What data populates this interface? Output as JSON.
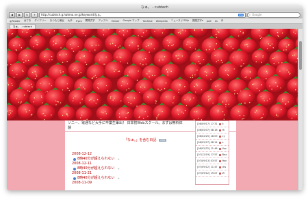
{
  "window": {
    "title": "なぁ。 - cubtech"
  },
  "toolbar": {
    "url": "http://cubtech.g.hatena.ne.jp/keyword/なぁ。",
    "rss": "RSS",
    "search_placeholder": "Google"
  },
  "bookmarks": [
    "g/Reader",
    "はてな",
    "ダイアリー",
    "まつもと最近",
    "大手",
    "ITpro",
    "開発文字",
    "アップル",
    "Viewer",
    "Google マップ",
    "YouTube",
    "Wikipedia",
    "ニュース (178)▾",
    "雑雑文字▾",
    "Joe▾",
    "ds",
    "ほ"
  ],
  "tab": {
    "label": "なぁ。 - cubtech"
  },
  "ad": {
    "line1": "ソニー、電通など大手に卒業生輩出！ 日本初Webスクール。まずは無料体",
    "line2": "験"
  },
  "diary": {
    "heading": "「なぁ。」を含む日記",
    "badge": "RSS"
  },
  "entries": [
    {
      "date": "2008-12-12",
      "title": "8時40分が超えられない"
    },
    {
      "date": "2008-12-11",
      "title": "8時40分が超えられない"
    },
    {
      "date": "2008-11-21",
      "title": "8時40分が超えられない"
    },
    {
      "date": "2008-11-09",
      "title": ""
    }
  ],
  "sidebar": [
    {
      "time": "[08/09/17] 17:31",
      "name": "k"
    },
    {
      "time": "[08/05/07] 08:18",
      "name": "Hi"
    },
    {
      "time": "[08/02/25] 18:09",
      "name": "cy"
    },
    {
      "time": "[08/02/27] 08:14",
      "name": "s"
    },
    {
      "time": "[08/02/22] 11:46",
      "name": "Yep"
    },
    {
      "time": "[07/12/19] 17:57",
      "name": "Bea"
    },
    {
      "time": "[07/09/13] 03:57",
      "name": "Han"
    },
    {
      "time": "[07/09/12] 11:47",
      "name": "drs"
    },
    {
      "time": "[07/09/12] 19:07",
      "name": "W"
    }
  ]
}
